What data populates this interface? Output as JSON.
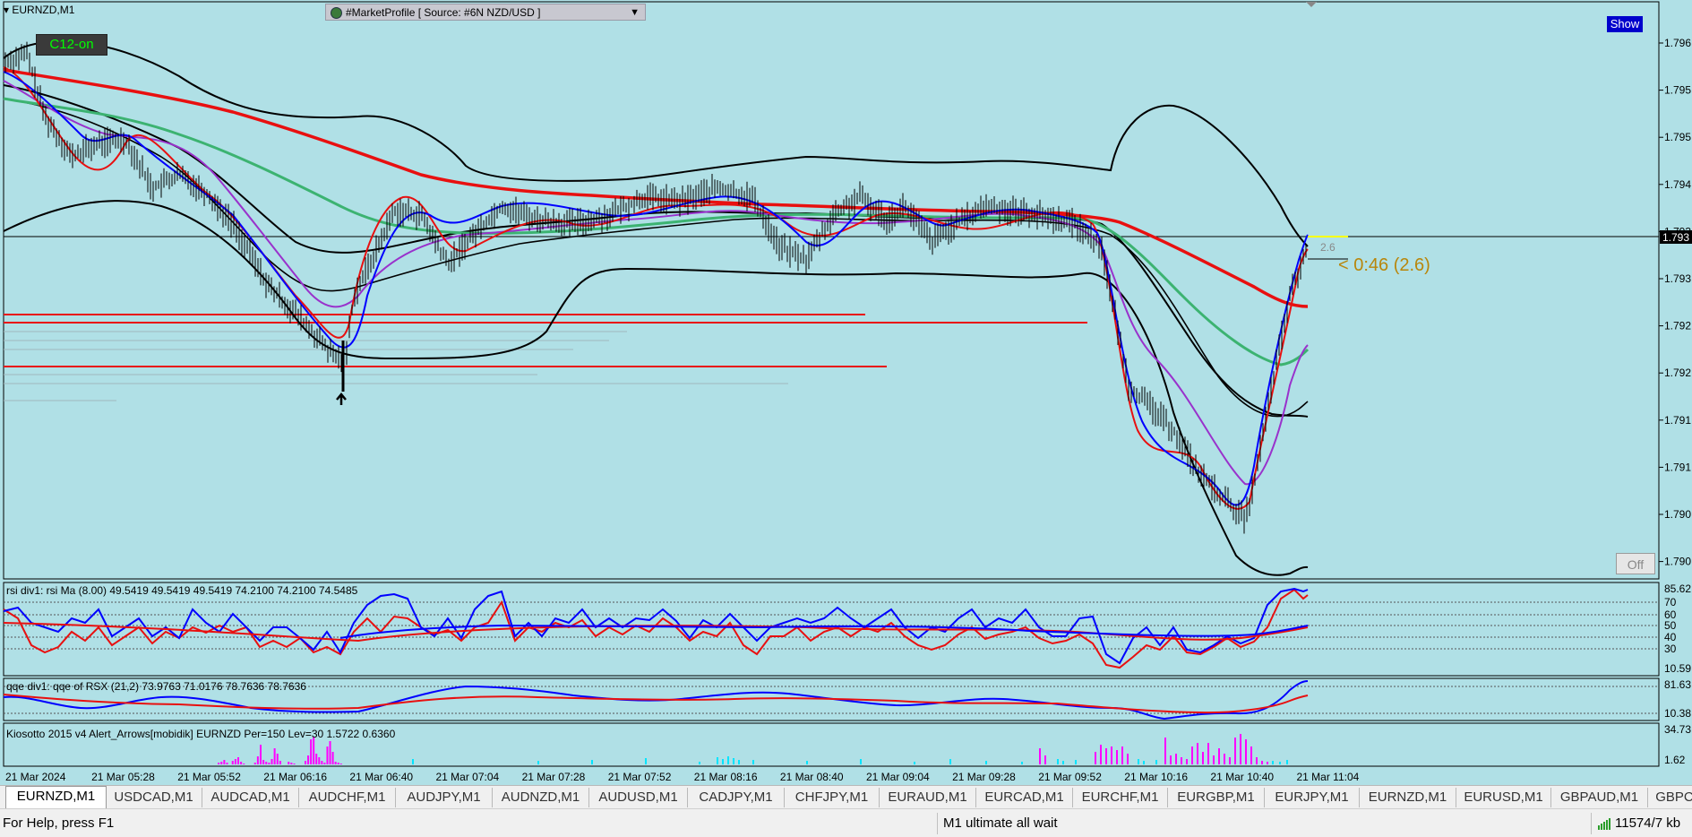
{
  "window": {
    "symbol_title": "EURNZD,M1",
    "market_profile_label": "#MarketProfile [ Source: #6N NZD/USD ]",
    "c12_badge": "C12-on",
    "show_button": "Show",
    "off_button": "Off",
    "timer_label": "< 0:46 (2.6)",
    "spread_label": "2.6",
    "current_price_label": "1.793"
  },
  "colors": {
    "chart_bg": "#b0e0e6",
    "ma_red": "#e81010",
    "ma_green": "#3cb371",
    "ma_blue": "#0000ff",
    "ma_purple": "#9932cc",
    "histogram_magenta": "#ff00ff",
    "histogram_cyan": "#00e5ff",
    "timer_gold": "#b8860b"
  },
  "price_axis": {
    "labels": [
      "1.796",
      "1.795",
      "1.795",
      "1.794",
      "1.793",
      "1.793",
      "1.792",
      "1.792",
      "1.791",
      "1.791",
      "1.790",
      "1.790"
    ]
  },
  "time_axis": {
    "labels": [
      "21 Mar 2024",
      "21 Mar 05:28",
      "21 Mar 05:52",
      "21 Mar 06:16",
      "21 Mar 06:40",
      "21 Mar 07:04",
      "21 Mar 07:28",
      "21 Mar 07:52",
      "21 Mar 08:16",
      "21 Mar 08:40",
      "21 Mar 09:04",
      "21 Mar 09:28",
      "21 Mar 09:52",
      "21 Mar 10:16",
      "21 Mar 10:40",
      "21 Mar 11:04"
    ]
  },
  "rsi_panel": {
    "label": "rsi div1: rsi Ma (8.00) 49.5419 49.5419 49.5419 74.2100 74.2100 74.5485",
    "levels": [
      "85.62",
      "70",
      "60",
      "50",
      "40",
      "30",
      "10.59"
    ]
  },
  "qqe_panel": {
    "label": "qqe div1: qqe of RSX (21,2) 73.9763 71.0176 78.7636 78.7636",
    "levels": [
      "81.63",
      "10.38"
    ]
  },
  "kiosotto_panel": {
    "label": "Kiosotto 2015 v4 Alert_Arrows[mobidik] EURNZD Per=150 Lev=30 1.5722 0.6360",
    "levels": [
      "34.73",
      "1.62"
    ]
  },
  "tabs": [
    {
      "label": "EURNZD,M1",
      "active": true
    },
    {
      "label": "USDCAD,M1"
    },
    {
      "label": "AUDCAD,M1"
    },
    {
      "label": "AUDCHF,M1"
    },
    {
      "label": "AUDJPY,M1"
    },
    {
      "label": "AUDNZD,M1"
    },
    {
      "label": "AUDUSD,M1"
    },
    {
      "label": "CADJPY,M1"
    },
    {
      "label": "CHFJPY,M1"
    },
    {
      "label": "EURAUD,M1"
    },
    {
      "label": "EURCAD,M1"
    },
    {
      "label": "EURCHF,M1"
    },
    {
      "label": "EURGBP,M1"
    },
    {
      "label": "EURJPY,M1"
    },
    {
      "label": "EURNZD,M1"
    },
    {
      "label": "EURUSD,M1"
    },
    {
      "label": "GBPAUD,M1"
    },
    {
      "label": "GBPC"
    }
  ],
  "status": {
    "help": "For Help, press F1",
    "mode": "M1 ultimate all wait",
    "traffic": "11574/7 kb"
  }
}
